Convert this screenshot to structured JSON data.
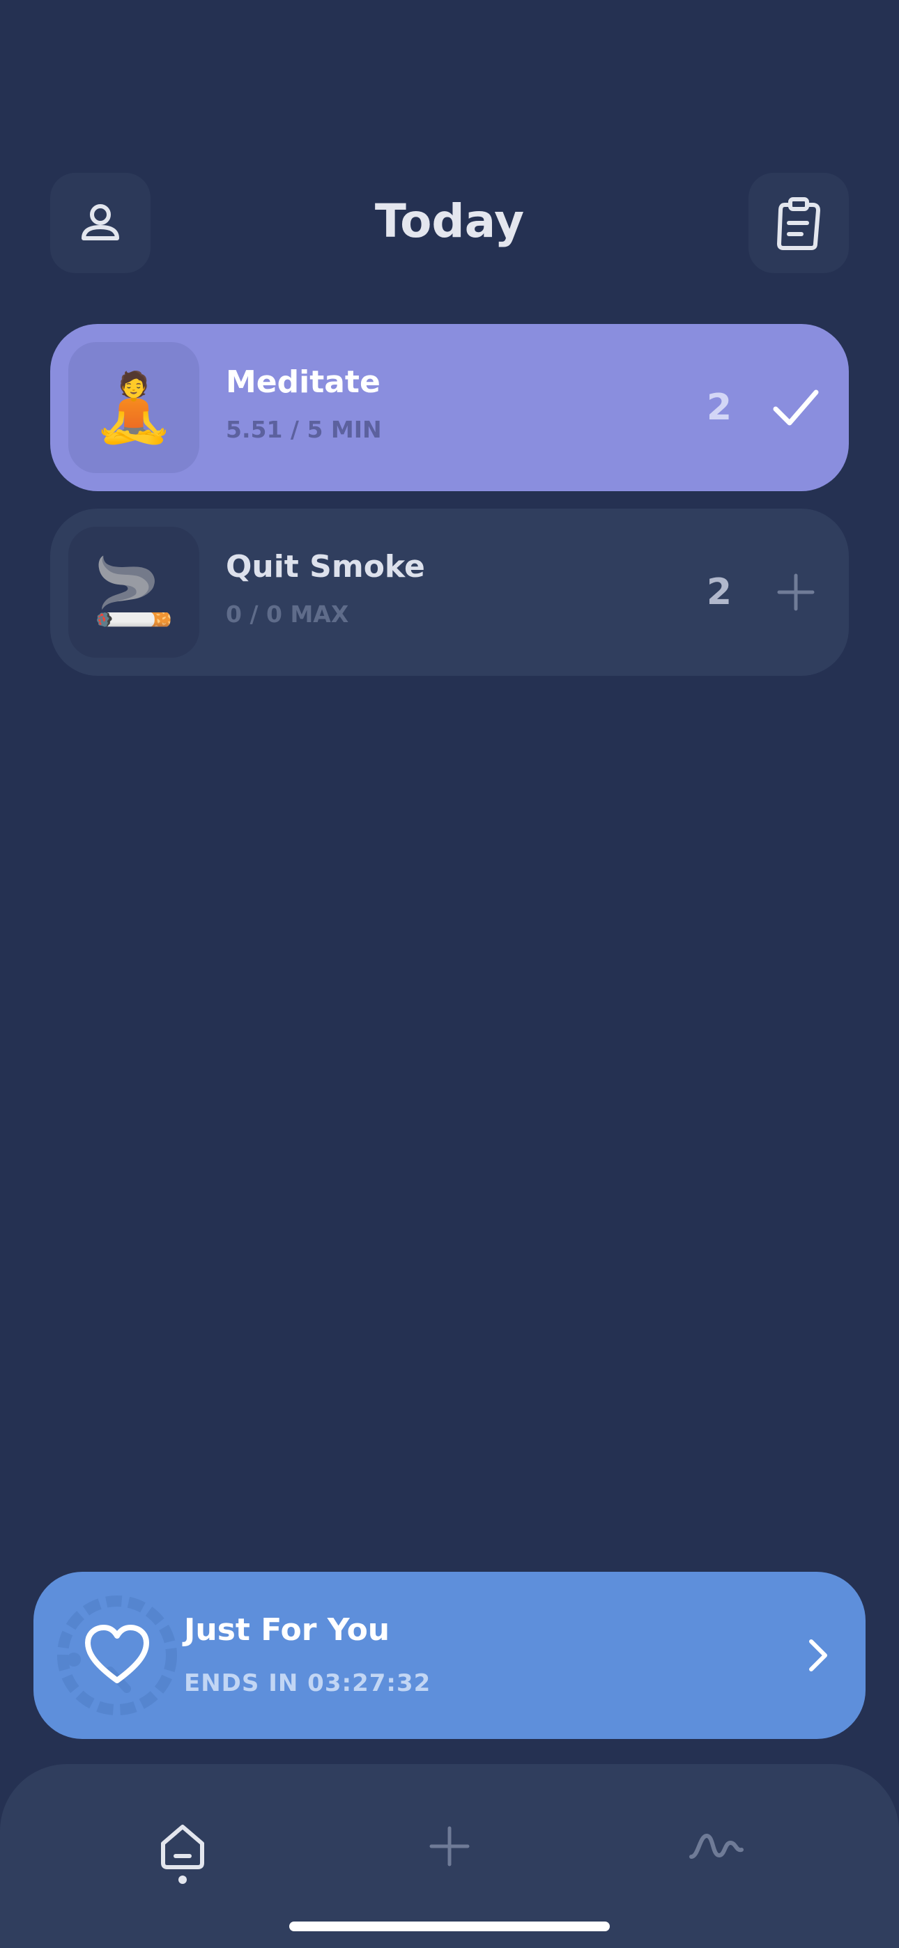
{
  "header": {
    "title": "Today",
    "profile_icon": "person-icon",
    "log_icon": "clipboard-icon"
  },
  "habits": [
    {
      "name": "Meditate",
      "emoji": "🧘",
      "progress": "5.51 / 5 MIN",
      "streak": "2",
      "action_icon": "checkmark-icon",
      "completed": true,
      "color": "#8a8ede"
    },
    {
      "name": "Quit Smoke",
      "emoji": "🚬",
      "progress": "0 / 0 MAX",
      "streak": "2",
      "action_icon": "plus-icon",
      "completed": false,
      "color": "#303e5e"
    }
  ],
  "promo": {
    "title": "Just For You",
    "subtitle": "ENDS IN 03:27:32",
    "icon": "heart-icon",
    "chevron_icon": "chevron-right-icon",
    "color": "#5e8fdb"
  },
  "tabbar": {
    "tabs": [
      {
        "icon": "home-icon",
        "active": true
      },
      {
        "icon": "plus-icon",
        "active": false
      },
      {
        "icon": "stats-wave-icon",
        "active": false
      }
    ]
  },
  "colors": {
    "background": "#253152",
    "surface": "#303e5e",
    "accent": "#8a8ede"
  }
}
